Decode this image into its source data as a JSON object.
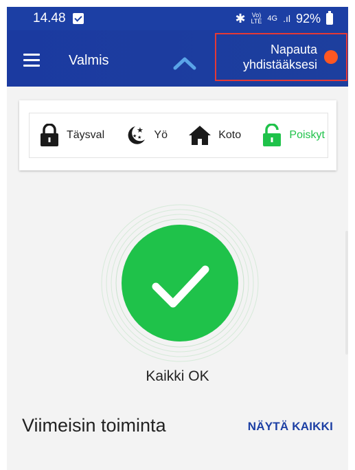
{
  "status_bar": {
    "time": "14.48",
    "network_small_top": "Vo)",
    "network_small_bottom": "LTE",
    "network_gen": "4G",
    "battery": "92%"
  },
  "app_bar": {
    "title": "Valmis",
    "connect_line1": "Napauta",
    "connect_line2": "yhdistääksesi",
    "connect_dot_color": "#ff5722"
  },
  "modes": [
    {
      "label": "Täysval",
      "icon": "lock-closed-icon"
    },
    {
      "label": "Yö",
      "icon": "moon-stars-icon"
    },
    {
      "label": "Koto",
      "icon": "home-icon"
    },
    {
      "label": "Poiskyt",
      "icon": "lock-open-icon",
      "active": true
    }
  ],
  "status": {
    "text": "Kaikki OK",
    "color": "#1fc24a"
  },
  "recent": {
    "title": "Viimeisin toiminta",
    "show_all": "NÄYTÄ KAIKKI"
  },
  "colors": {
    "brand": "#1c3fa4",
    "accent_green": "#1fc24a",
    "highlight_red": "#e53935"
  }
}
